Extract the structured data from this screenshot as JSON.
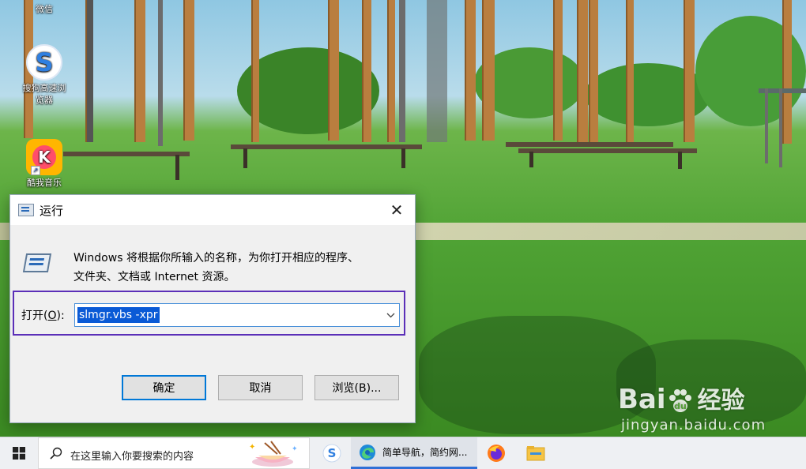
{
  "desktop": {
    "icons": [
      {
        "label": "微信"
      },
      {
        "label": "搜狗高速浏览器",
        "label_line1": "搜狗高速浏",
        "label_line2": "览器"
      },
      {
        "label": "酷我音乐"
      }
    ]
  },
  "run_dialog": {
    "title": "运行",
    "close_glyph": "✕",
    "description_line1": "Windows 将根据你所输入的名称，为你打开相应的程序、",
    "description_line2": "文件夹、文档或 Internet 资源。",
    "open_label_prefix": "打开(",
    "open_label_key": "O",
    "open_label_suffix": "):",
    "command_value": "slmgr.vbs -xpr",
    "buttons": {
      "ok": "确定",
      "cancel": "取消",
      "browse": "浏览(B)..."
    }
  },
  "watermark": {
    "brand": "Bai",
    "brand_tail": "",
    "product": "经验",
    "url": "jingyan.baidu.com"
  },
  "taskbar": {
    "search_placeholder": "在这里输入你要搜索的内容",
    "edge_window_title": "简单导航，简约网...",
    "icons": [
      "windows-start-icon",
      "search-icon",
      "sogou-browser-icon",
      "edge-icon",
      "firefox-icon",
      "file-explorer-icon"
    ]
  },
  "colors": {
    "highlight_border": "#5b2fb8",
    "selection": "#0a5ad6",
    "default_button_border": "#0078d7"
  }
}
